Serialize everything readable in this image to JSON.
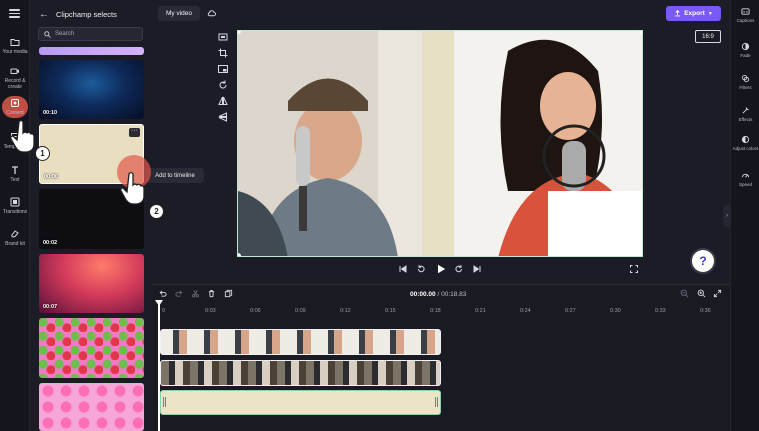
{
  "panel": {
    "title": "Clipchamp selects",
    "search_placeholder": "Search",
    "thumbs": [
      {
        "duration": "00:10"
      },
      {
        "duration": "00:00"
      },
      {
        "duration": "00:02"
      },
      {
        "duration": "00:07"
      },
      {
        "duration": ""
      },
      {
        "duration": ""
      }
    ]
  },
  "nav": {
    "items": [
      {
        "label": "Your media",
        "icon": "folder-icon"
      },
      {
        "label": "Record & create",
        "icon": "video-camera-icon"
      },
      {
        "label": "Content",
        "icon": "content-library-icon"
      },
      {
        "label": "Templates",
        "icon": "templates-icon"
      },
      {
        "label": "Text",
        "icon": "text-icon"
      },
      {
        "label": "Transitions",
        "icon": "transitions-icon"
      },
      {
        "label": "Brand kit",
        "icon": "brand-kit-icon"
      }
    ]
  },
  "tooltip": {
    "text": "Add to timeline"
  },
  "header": {
    "project_name": "My video",
    "export_label": "Export"
  },
  "right_rail": {
    "items": [
      {
        "label": "Captions",
        "icon": "captions-icon"
      },
      {
        "label": "Fade",
        "icon": "fade-icon"
      },
      {
        "label": "Filters",
        "icon": "filters-icon"
      },
      {
        "label": "Effects",
        "icon": "effects-icon"
      },
      {
        "label": "Adjust colors",
        "icon": "adjust-colors-icon"
      },
      {
        "label": "Speed",
        "icon": "speed-icon"
      }
    ]
  },
  "preview": {
    "aspect_ratio": "16:9",
    "help_label": "?"
  },
  "timeline": {
    "current_time": "00:00.00",
    "total_time": "00:18.83",
    "ticks": [
      "0",
      "0:03",
      "0:06",
      "0:09",
      "0:12",
      "0:15",
      "0:18",
      "0:21",
      "0:24",
      "0:27",
      "0:30",
      "0:33",
      "0:36"
    ]
  },
  "steps": {
    "step1": "1",
    "step2": "2"
  },
  "colors": {
    "accent": "#7a5af5",
    "selection": "#8ad0ae",
    "audio_clip": "#eae5c6",
    "background": "#1c1c26"
  }
}
